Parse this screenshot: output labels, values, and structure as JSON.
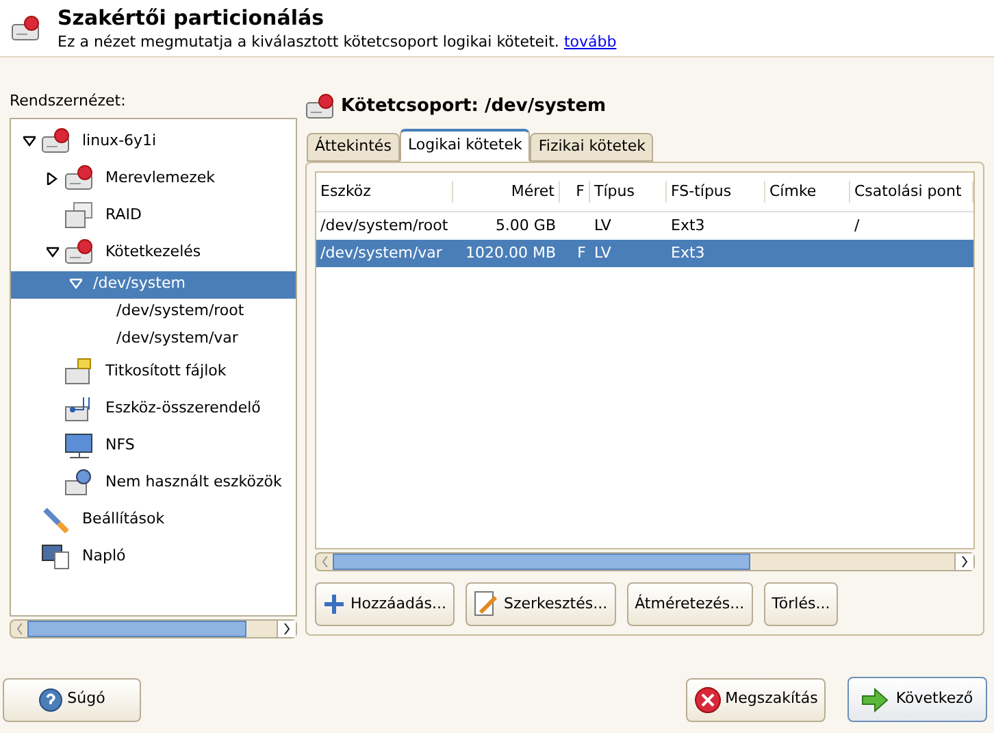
{
  "header": {
    "title": "Szakértői particionálás",
    "description": "Ez a nézet megmutatja a kiválasztott kötetcsoport logikai köteteit.",
    "link": "tovább"
  },
  "sidebar": {
    "label": "Rendszernézet:",
    "tree": [
      {
        "label": "linux-6y1i",
        "kind": "disk",
        "expanded": true,
        "selected": false,
        "children": [
          {
            "label": "Merevlemezek",
            "kind": "disk",
            "expanded": false,
            "selected": false
          },
          {
            "label": "RAID",
            "kind": "raid",
            "selected": false
          },
          {
            "label": "Kötetkezelés",
            "kind": "disk",
            "expanded": true,
            "selected": false,
            "children": [
              {
                "label": "/dev/system",
                "expanded": true,
                "selected": true,
                "children": [
                  {
                    "label": "/dev/system/root",
                    "selected": false
                  },
                  {
                    "label": "/dev/system/var",
                    "selected": false
                  }
                ]
              }
            ]
          },
          {
            "label": "Titkosított fájlok",
            "kind": "crypt",
            "selected": false
          },
          {
            "label": "Eszköz-összerendelő",
            "kind": "mapper",
            "selected": false
          },
          {
            "label": "NFS",
            "kind": "nfs",
            "selected": false
          },
          {
            "label": "Nem használt eszközök",
            "kind": "unused",
            "selected": false
          }
        ]
      },
      {
        "label": "Beállítások",
        "kind": "settings",
        "selected": false
      },
      {
        "label": "Napló",
        "kind": "log",
        "selected": false
      }
    ]
  },
  "panel": {
    "title": "Kötetcsoport: /dev/system",
    "tabs": [
      {
        "label": "Áttekintés",
        "selected": false
      },
      {
        "label": "Logikai kötetek",
        "selected": true
      },
      {
        "label": "Fizikai kötetek",
        "selected": false
      }
    ],
    "table": {
      "columns": [
        "Eszköz",
        "Méret",
        "F",
        "Típus",
        "FS-típus",
        "Címke",
        "Csatolási pont"
      ],
      "rows": [
        {
          "cells": [
            "/dev/system/root",
            "5.00 GB",
            "",
            "LV",
            "Ext3",
            "",
            "/"
          ],
          "selected": false
        },
        {
          "cells": [
            "/dev/system/var",
            "1020.00 MB",
            "F",
            "LV",
            "Ext3",
            "",
            ""
          ],
          "selected": true
        }
      ]
    },
    "buttons": [
      {
        "label": "Hozzáadás...",
        "kind": "add"
      },
      {
        "label": "Szerkesztés...",
        "kind": "edit"
      },
      {
        "label": "Átméretezés...",
        "kind": "plain"
      },
      {
        "label": "Törlés...",
        "kind": "plain"
      }
    ]
  },
  "footer": {
    "help": "Súgó",
    "cancel": "Megszakítás",
    "next": "Következő"
  }
}
